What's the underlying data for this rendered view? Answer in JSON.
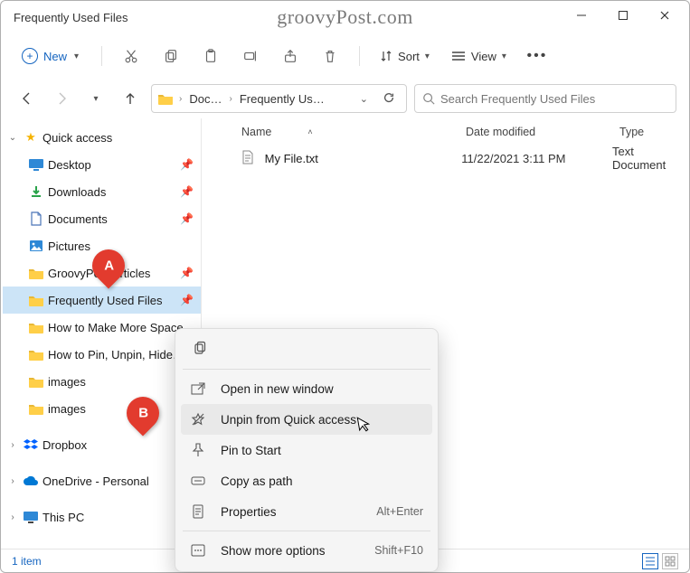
{
  "titlebar": {
    "title": "Frequently Used Files",
    "watermark": "groovyPost.com"
  },
  "toolbar": {
    "new_label": "New",
    "sort_label": "Sort",
    "view_label": "View"
  },
  "addressbar": {
    "crumb1": "Doc…",
    "crumb2": "Frequently Us…",
    "search_placeholder": "Search Frequently Used Files"
  },
  "sidebar": {
    "quick_access": "Quick access",
    "items": [
      {
        "label": "Desktop",
        "pinned": true
      },
      {
        "label": "Downloads",
        "pinned": true
      },
      {
        "label": "Documents",
        "pinned": true
      },
      {
        "label": "Pictures",
        "pinned": true
      },
      {
        "label": "GroovyPost Articles",
        "pinned": true
      },
      {
        "label": "Frequently Used Files",
        "pinned": true
      },
      {
        "label": "How to Make More Space…",
        "pinned": false
      },
      {
        "label": "How to Pin, Unpin, Hide…",
        "pinned": false
      },
      {
        "label": "images",
        "pinned": false
      },
      {
        "label": "images",
        "pinned": false
      }
    ],
    "dropbox": "Dropbox",
    "onedrive": "OneDrive - Personal",
    "this_pc": "This PC"
  },
  "columns": {
    "name": "Name",
    "date": "Date modified",
    "type": "Type"
  },
  "files": [
    {
      "name": "My File.txt",
      "date": "11/22/2021 3:11 PM",
      "type": "Text Document"
    }
  ],
  "context_menu": {
    "open_new_window": "Open in new window",
    "unpin": "Unpin from Quick access",
    "pin_start": "Pin to Start",
    "copy_path": "Copy as path",
    "properties": "Properties",
    "properties_shortcut": "Alt+Enter",
    "show_more": "Show more options",
    "show_more_shortcut": "Shift+F10"
  },
  "status": {
    "item_count": "1 item"
  },
  "markers": {
    "a": "A",
    "b": "B"
  }
}
